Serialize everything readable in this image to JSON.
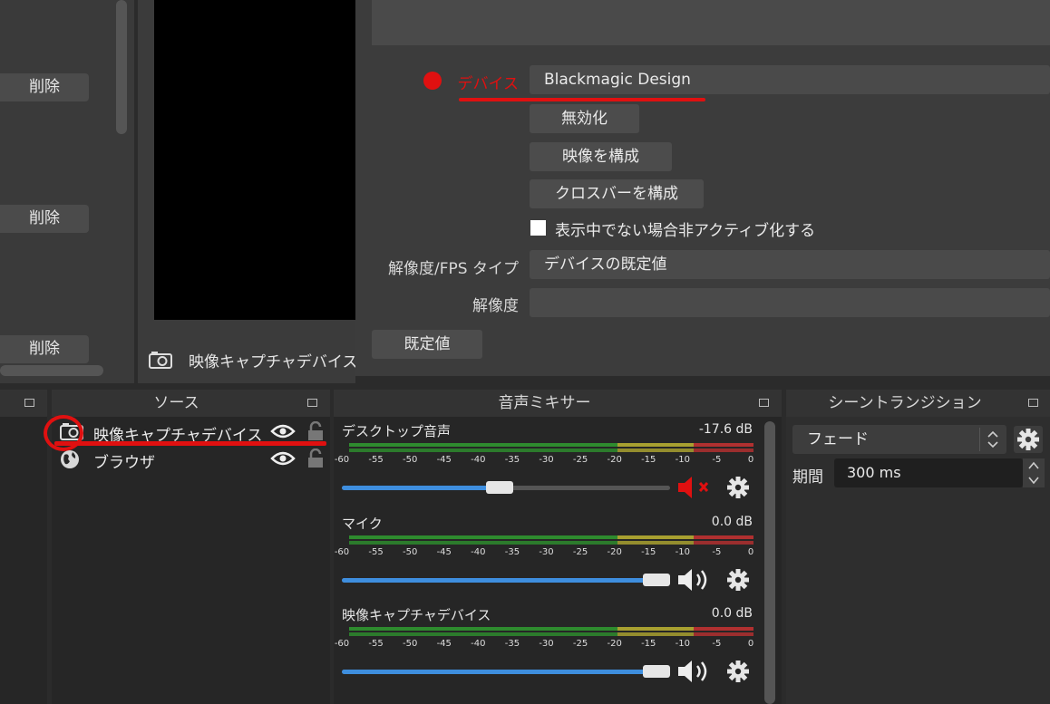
{
  "scenes": {
    "delete_label": "削除"
  },
  "preview": {
    "source_name": "映像キャプチャデバイス"
  },
  "properties": {
    "device_label": "デバイス",
    "device_value": "Blackmagic Design",
    "deactivate_button": "無効化",
    "configure_video_button": "映像を構成",
    "configure_crossbar_button": "クロスバーを構成",
    "deactivate_when_hidden_label": "表示中でない場合非アクティブ化する",
    "resolution_fps_label": "解像度/FPS タイプ",
    "resolution_fps_value": "デバイスの既定値",
    "resolution_label": "解像度",
    "resolution_value": "",
    "defaults_button": "既定値"
  },
  "sources_dock": {
    "title": "ソース",
    "items": [
      {
        "name": "映像キャプチャデバイス",
        "icon": "camera-icon"
      },
      {
        "name": "ブラウザ",
        "icon": "globe-icon"
      }
    ]
  },
  "mixer_dock": {
    "title": "音声ミキサー",
    "ticks": [
      "-60",
      "-55",
      "-50",
      "-45",
      "-40",
      "-35",
      "-30",
      "-25",
      "-20",
      "-15",
      "-10",
      "-5",
      "0"
    ],
    "channels": [
      {
        "name": "デスクトップ音声",
        "db": "-17.6 dB",
        "volume": 0.48,
        "muted": true
      },
      {
        "name": "マイク",
        "db": "0.0 dB",
        "volume": 1.0,
        "muted": false
      },
      {
        "name": "映像キャプチャデバイス",
        "db": "0.0 dB",
        "volume": 1.0,
        "muted": false
      }
    ]
  },
  "transitions_dock": {
    "title": "シーントランジション",
    "transition": "フェード",
    "duration_label": "期間",
    "duration_value": "300 ms"
  },
  "colors": {
    "annotation_red": "#e01010",
    "meter_green": "#2e8b2e",
    "meter_yellow": "#a8a030",
    "meter_red": "#b03030",
    "slider_blue": "#3e8ede"
  }
}
